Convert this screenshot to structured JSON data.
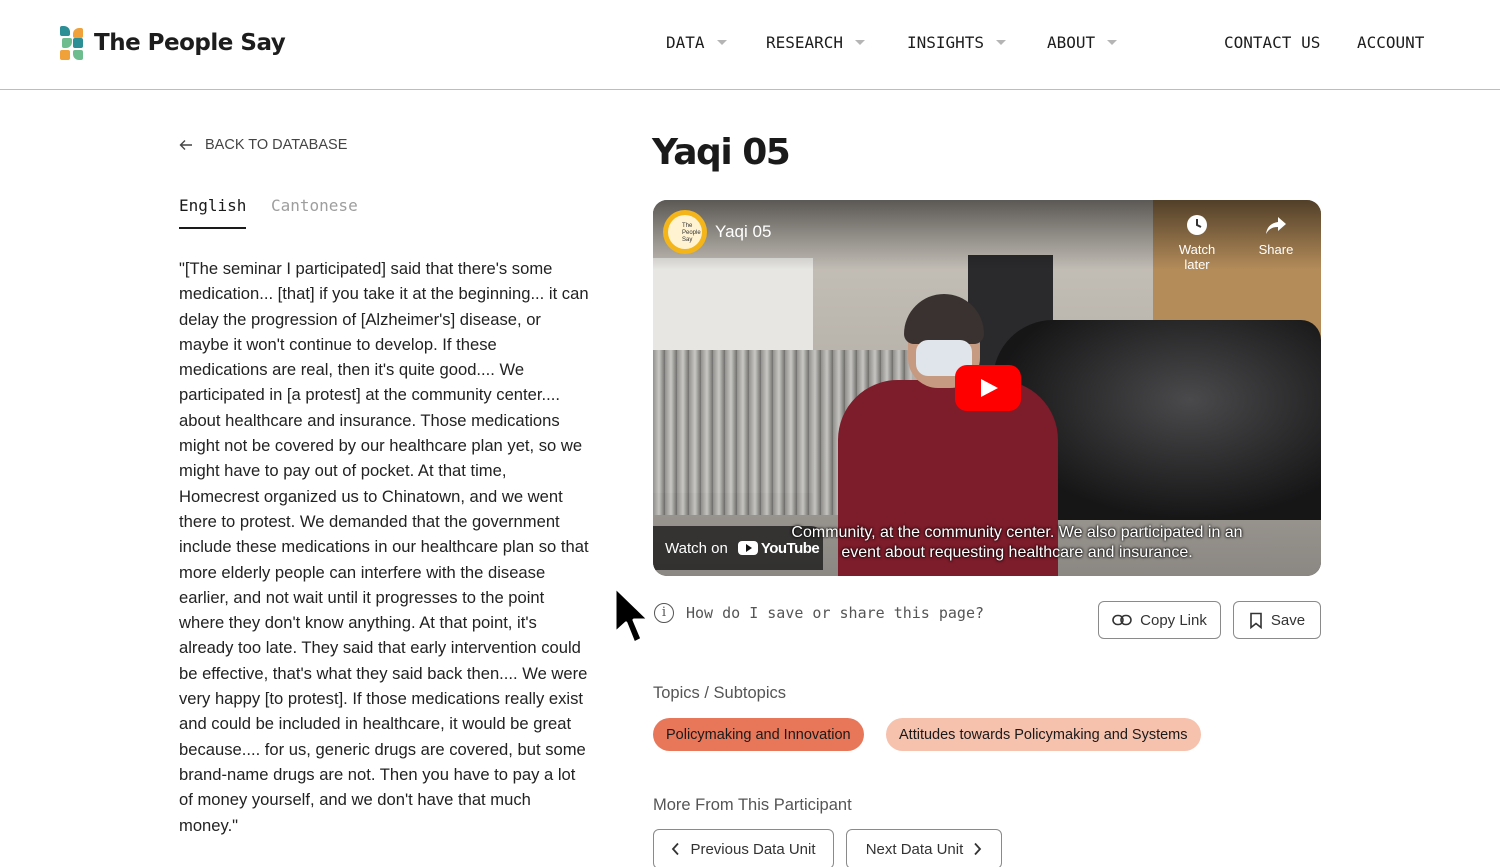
{
  "header": {
    "brand": "The People Say",
    "nav": [
      {
        "label": "DATA",
        "has_dropdown": true
      },
      {
        "label": "RESEARCH",
        "has_dropdown": true
      },
      {
        "label": "INSIGHTS",
        "has_dropdown": true
      },
      {
        "label": "ABOUT",
        "has_dropdown": true
      }
    ],
    "contact": "CONTACT US",
    "account": "ACCOUNT"
  },
  "left": {
    "back_label": "BACK TO DATABASE",
    "tabs": [
      {
        "label": "English",
        "active": true
      },
      {
        "label": "Cantonese",
        "active": false
      }
    ],
    "quote": "\"[The seminar I participated] said that there's some medication... [that] if you take it at the beginning... it can delay the progression of [Alzheimer's] disease, or maybe it won't continue to develop. If these medications are real, then it's quite good.... We participated in [a protest] at the community center.... about healthcare and insurance. Those medications might not be covered by our healthcare plan yet, so we might have to pay out of pocket. At that time, Homecrest organized us to Chinatown, and we went there to protest. We demanded that the government include these medications in our healthcare plan so that more elderly people can interfere with the disease earlier, and not wait until it progresses to the point where they don't know anything. At that point, it's already too late. They said that early intervention could be effective, that's what they said back then.... We were very happy [to protest]. If those medications really exist and could be included in healthcare, it would be great because.... for us, generic drugs are covered, but some brand-name drugs are not. Then you have to pay a lot of money yourself, and we don't have that much money.\""
  },
  "main": {
    "title": "Yaqi 05",
    "video": {
      "title": "Yaqi 05",
      "channel_logo_text": "The People Say",
      "watch_later": "Watch later",
      "share": "Share",
      "watch_on": "Watch on",
      "youtube": "YouTube",
      "subtitle_line1": "Community, at the community center. We also participated in an",
      "subtitle_line2": "event about requesting healthcare and insurance."
    },
    "info_text": "How do I save or share this page?",
    "copy_link": "Copy Link",
    "save": "Save",
    "topics_label": "Topics / Subtopics",
    "topics": [
      {
        "label": "Policymaking and Innovation",
        "color": "#e8775a"
      },
      {
        "label": "Attitudes towards Policymaking and Systems",
        "color": "#f6c1ad"
      }
    ],
    "more_label": "More From This Participant",
    "prev": "Previous Data Unit",
    "next": "Next Data Unit"
  },
  "colors": {
    "logo_teal": "#2b8f95",
    "logo_orange": "#f0a13a",
    "logo_green": "#6dbd8f",
    "youtube_red": "#ff0000"
  }
}
